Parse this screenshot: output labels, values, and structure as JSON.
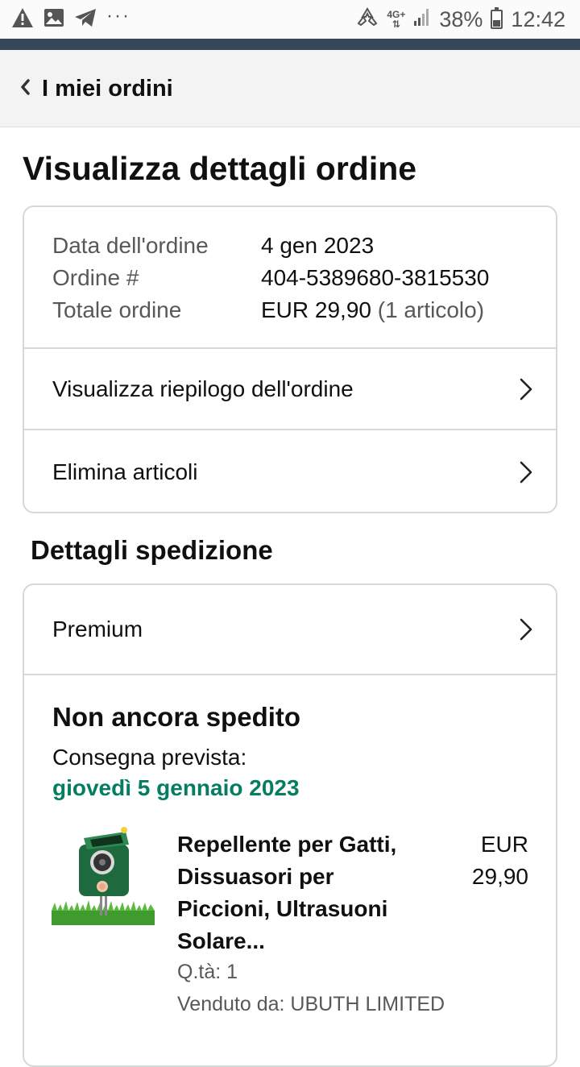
{
  "status_bar": {
    "left_icons": [
      "warning-icon",
      "image-icon",
      "telegram-icon",
      "more-dots-icon"
    ],
    "network_top": "4G+",
    "network_bottom": "⇅",
    "battery_percent": "38%",
    "time": "12:42"
  },
  "nav": {
    "back_label": "I miei ordini"
  },
  "page": {
    "title": "Visualizza dettagli ordine"
  },
  "order_info": {
    "date_label": "Data dell'ordine",
    "date_value": "4 gen 2023",
    "number_label": "Ordine #",
    "number_value": "404-5389680-3815530",
    "total_label": "Totale ordine",
    "total_value": "EUR 29,90",
    "total_items": "(1 articolo)"
  },
  "actions": {
    "summary_label": "Visualizza riepilogo dell'ordine",
    "delete_label": "Elimina articoli"
  },
  "shipping": {
    "section_title": "Dettagli spedizione",
    "method_label": "Premium",
    "status": "Non ancora spedito",
    "delivery_label": "Consegna prevista:",
    "delivery_date": "giovedì 5 gennaio 2023"
  },
  "product": {
    "title": "Repellente per Gatti, Dissuasori per Piccioni, Ultrasuoni Solare...",
    "price_currency": "EUR",
    "price_value": "29,90",
    "qty": "Q.tà: 1",
    "seller": "Venduto da: UBUTH LIMITED"
  },
  "colors": {
    "accent_dark": "#37475a",
    "delivery_green": "#067d62",
    "border": "#d5d9d9"
  }
}
